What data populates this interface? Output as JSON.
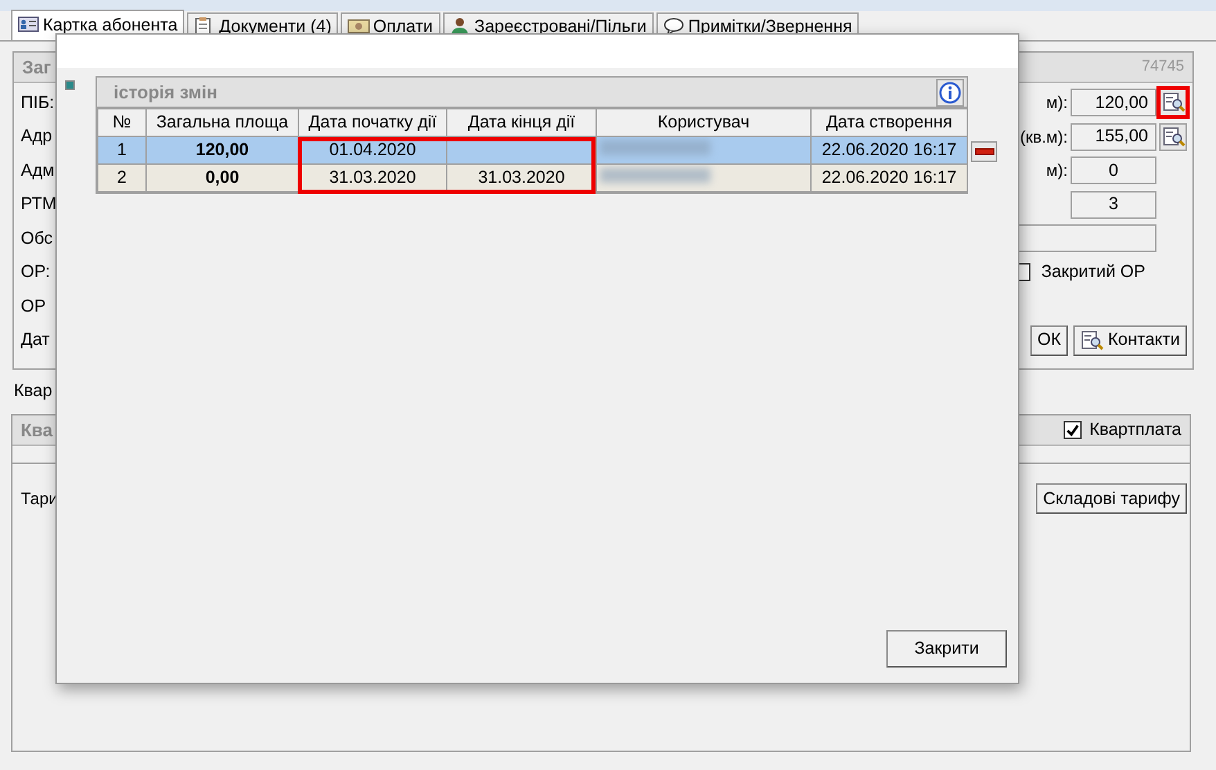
{
  "tabs": [
    {
      "label": "Картка абонента",
      "selected": true
    },
    {
      "label": "Документи (4)",
      "selected": false
    },
    {
      "label": "Оплати",
      "selected": false
    },
    {
      "label": "Зареєстровані/Пільги",
      "selected": false
    },
    {
      "label": "Примітки/Звернення",
      "selected": false
    }
  ],
  "main_group": {
    "title": "Заг",
    "number": "74745",
    "labels": [
      "ПІБ:",
      "Адр",
      "Адм",
      "РТМ",
      "Обс",
      "ОР:",
      "ОР",
      "Дат"
    ],
    "fields": [
      {
        "label": "м):",
        "value": "120,00",
        "kind": "lookup",
        "highlighted": true
      },
      {
        "label": "(кв.м):",
        "value": "155,00",
        "kind": "lookup",
        "highlighted": false
      },
      {
        "label": "м):",
        "value": "0",
        "kind": "plain"
      },
      {
        "value": "3",
        "kind": "plain"
      },
      {
        "kind": "wide"
      }
    ],
    "closed_checkbox": {
      "label": "Закритий ОР",
      "checked": false
    },
    "buttons": [
      {
        "label": "ОК",
        "icon": false
      },
      {
        "label": "Контакти",
        "icon": true
      }
    ]
  },
  "section_label": "Квар",
  "tariff_group": {
    "title": "Ква",
    "checkbox": {
      "label": "Квартплата",
      "checked": true
    },
    "label": "Тари",
    "button": "Складові тарифу"
  },
  "dialog": {
    "grid_title": "історія змін",
    "highlight_dates": true,
    "columns": [
      "№",
      "Загальна площа",
      "Дата початку дії",
      "Дата кінця дії",
      "Користувач",
      "Дата створення"
    ],
    "rows": [
      {
        "number": "1",
        "area": "120,00",
        "start": "01.04.2020",
        "user_blurred": true,
        "created": "22.06.2020 16:17",
        "selected": true
      },
      {
        "number": "2",
        "area": "0,00",
        "start": "31.03.2020",
        "end": "31.03.2020",
        "user_blurred": true,
        "created": "22.06.2020 16:17",
        "selected": false
      }
    ],
    "close_button": "Закрити"
  }
}
